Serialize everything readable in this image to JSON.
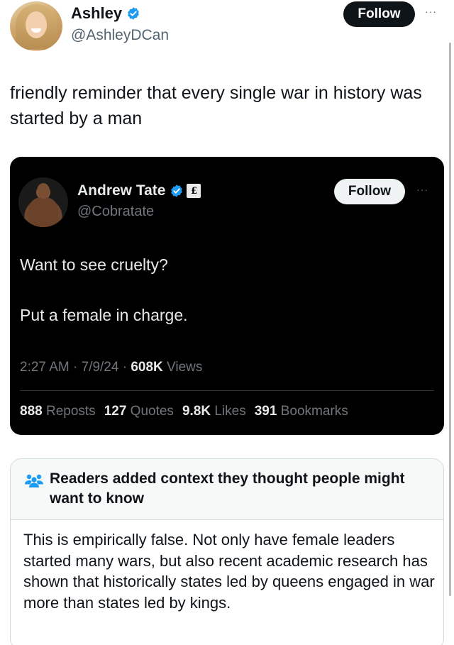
{
  "author": {
    "display_name": "Ashley",
    "handle": "@AshleyDCan",
    "follow_label": "Follow",
    "verified_color": "#1d9bf0"
  },
  "tweet": {
    "text": "friendly reminder that every single war in history was started by a man"
  },
  "quoted": {
    "display_name": "Andrew Tate",
    "handle": "@Cobratate",
    "follow_label": "Follow",
    "badge_glyph": "£",
    "line1": "Want to see cruelty?",
    "line2": "Put a female in charge.",
    "time": "2:27 AM",
    "date": "7/9/24",
    "views_count": "608K",
    "views_label": "Views",
    "separator": "·",
    "stats": [
      {
        "count": "888",
        "label": "Reposts"
      },
      {
        "count": "127",
        "label": "Quotes"
      },
      {
        "count": "9.8K",
        "label": "Likes"
      },
      {
        "count": "391",
        "label": "Bookmarks"
      }
    ]
  },
  "community_note": {
    "title": "Readers added context they thought people might want to know",
    "body": "This is empirically false. Not only have female leaders started many wars, but also recent academic research has shown that historically states led by queens engaged in war more than states led by kings.",
    "icon": "community-notes-icon",
    "icon_color": "#1d9bf0"
  },
  "more_glyph": "···"
}
